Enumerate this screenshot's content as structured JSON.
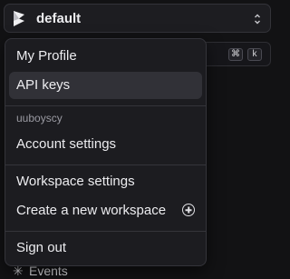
{
  "workspace_switcher": {
    "name": "default",
    "logo_icon": "prefect-logo-icon",
    "toggle_icon": "chevron-up-down-icon"
  },
  "search": {
    "shortcut_cmd": "⌘",
    "shortcut_key": "k"
  },
  "nav": {
    "events_label": "Events",
    "events_icon": "asterisk-icon"
  },
  "menu": {
    "my_profile": "My Profile",
    "api_keys": "API keys",
    "username": "uuboyscy",
    "account_settings": "Account settings",
    "workspace_settings": "Workspace settings",
    "create_workspace": "Create a new workspace",
    "create_workspace_icon": "plus-circle-icon",
    "sign_out": "Sign out"
  },
  "colors": {
    "background": "#121214",
    "menu_bg": "#1c1c20",
    "active_item_bg": "#313137",
    "muted_text": "#9a9aa2"
  }
}
